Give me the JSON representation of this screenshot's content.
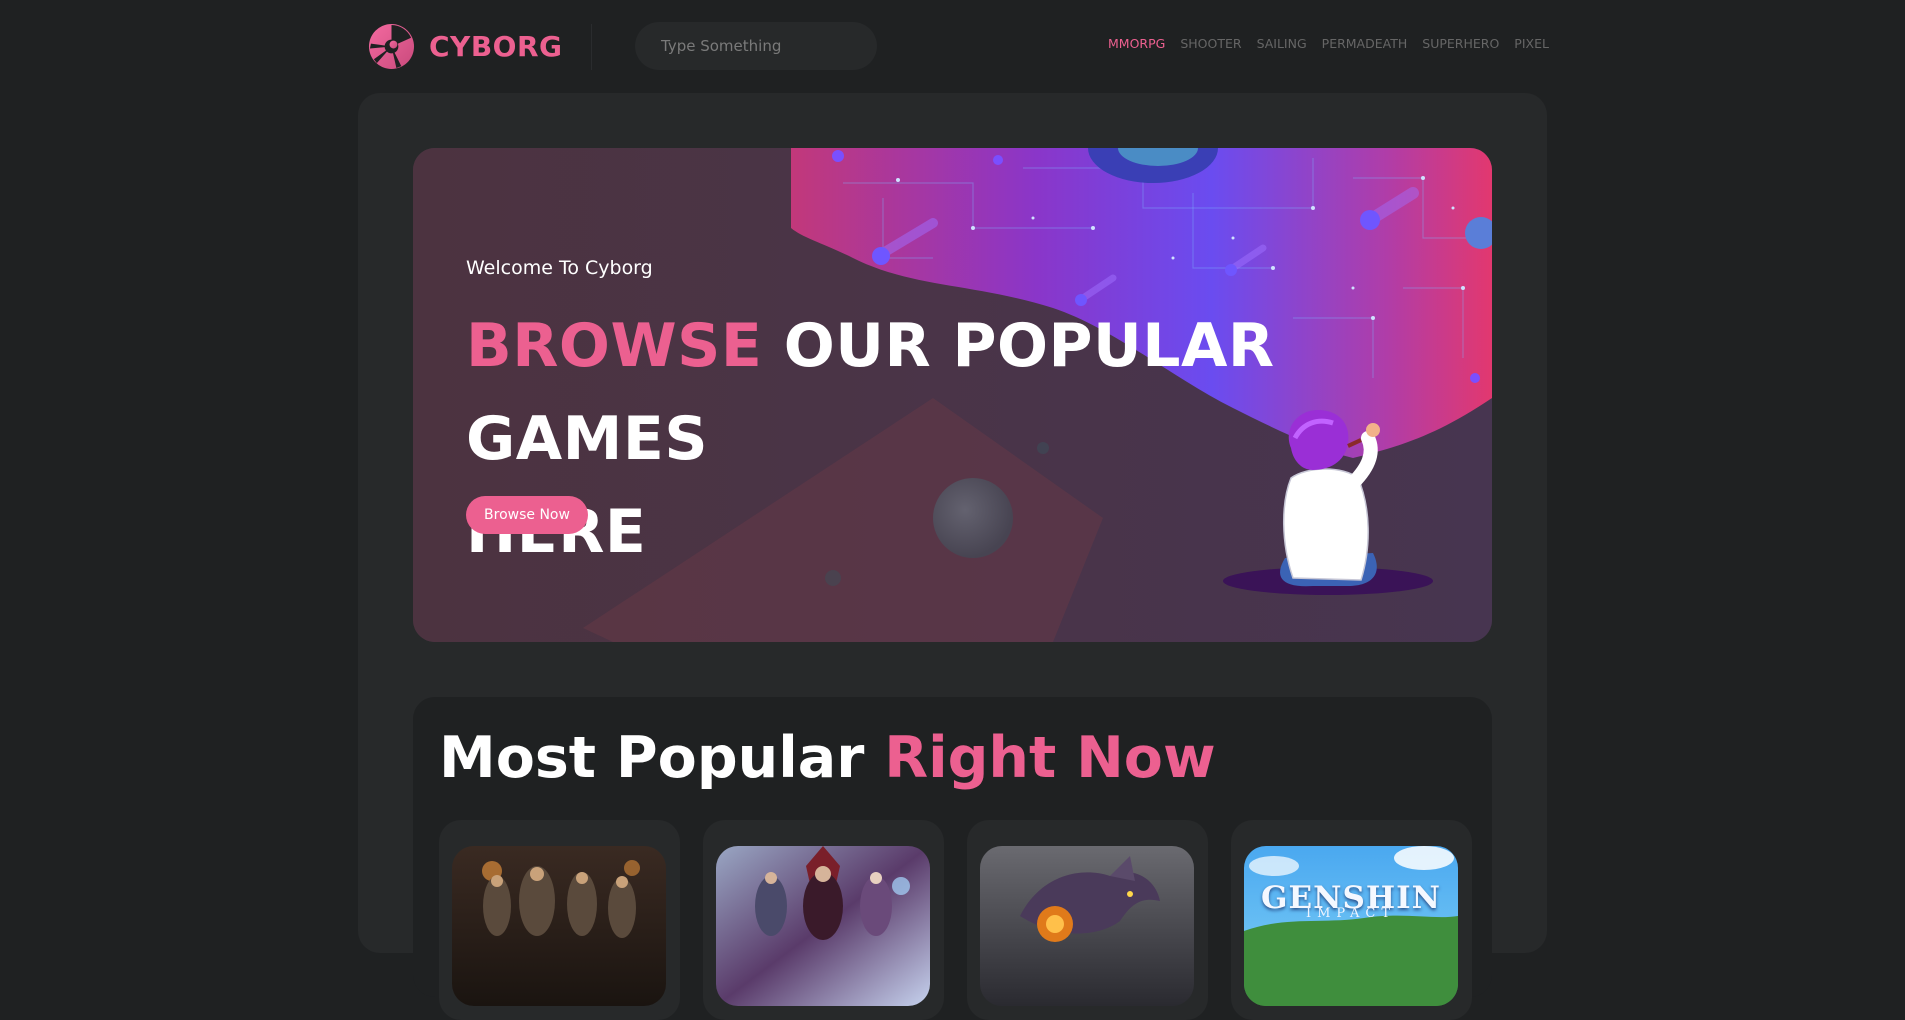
{
  "brand": {
    "name": "CYBORG",
    "accent_color": "#ec6090",
    "logo_icon": "cyborg-logo-icon"
  },
  "search": {
    "placeholder": "Type Something"
  },
  "nav": {
    "items": [
      {
        "label": "MMORPG",
        "active": true
      },
      {
        "label": "SHOOTER",
        "active": false
      },
      {
        "label": "SAILING",
        "active": false
      },
      {
        "label": "PERMADEATH",
        "active": false
      },
      {
        "label": "SUPERHERO",
        "active": false
      },
      {
        "label": "PIXEL",
        "active": false
      }
    ]
  },
  "hero": {
    "subtitle": "Welcome To Cyborg",
    "title_highlight": "BROWSE",
    "title_rest_line1": " OUR POPULAR GAMES",
    "title_rest_line2": "HERE",
    "button_label": "Browse Now"
  },
  "popular": {
    "heading_white": "Most Popular",
    "heading_pink": "Right Now",
    "games": [
      {
        "thumb": "dark-fantasy-heroes-art",
        "caption": "",
        "caption_sub": ""
      },
      {
        "thumb": "multi-hero-battle-art",
        "caption": "",
        "caption_sub": ""
      },
      {
        "thumb": "dragon-creature-art",
        "caption": "",
        "caption_sub": ""
      },
      {
        "thumb": "genshin-impact-logo-art",
        "caption": "GENSHIN",
        "caption_sub": "IMPACT"
      }
    ]
  },
  "colors": {
    "page_bg": "#1f2122",
    "panel_bg": "#27292a",
    "hero_bg": "#4a3443",
    "nav_inactive": "#666666"
  }
}
